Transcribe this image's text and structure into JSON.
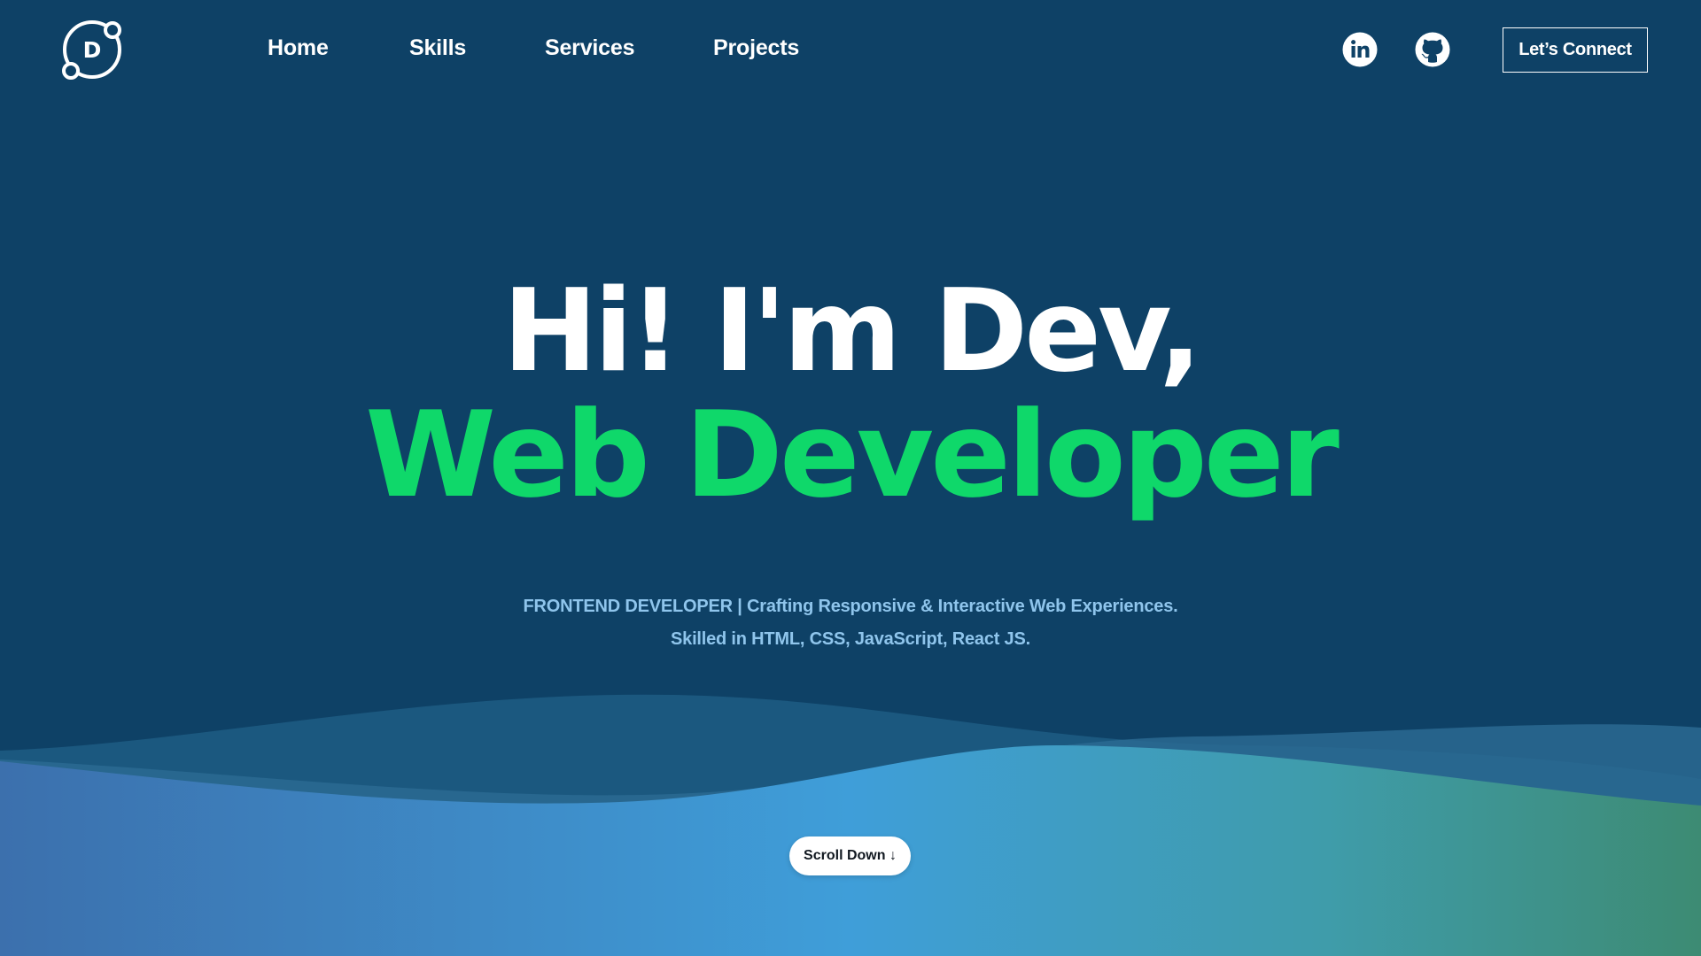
{
  "nav": {
    "logo_letter": "D",
    "links": [
      {
        "label": "Home"
      },
      {
        "label": "Skills"
      },
      {
        "label": "Services"
      },
      {
        "label": "Projects"
      }
    ],
    "social": [
      {
        "icon": "linkedin-icon"
      },
      {
        "icon": "github-icon"
      }
    ],
    "cta_label": "Let’s Connect"
  },
  "hero": {
    "greeting": "Hi! I'm Dev,",
    "role": "Web Developer",
    "tagline_line1": "FRONTEND DEVELOPER | Crafting Responsive & Interactive Web Experiences.",
    "tagline_line2": "Skilled in HTML, CSS, JavaScript, React JS."
  },
  "scroll_button": {
    "label": "Scroll Down ↓"
  },
  "colors": {
    "background": "#0e4166",
    "accent_green": "#0fd86a",
    "tagline": "#8fc5ec",
    "text": "#ffffff"
  }
}
